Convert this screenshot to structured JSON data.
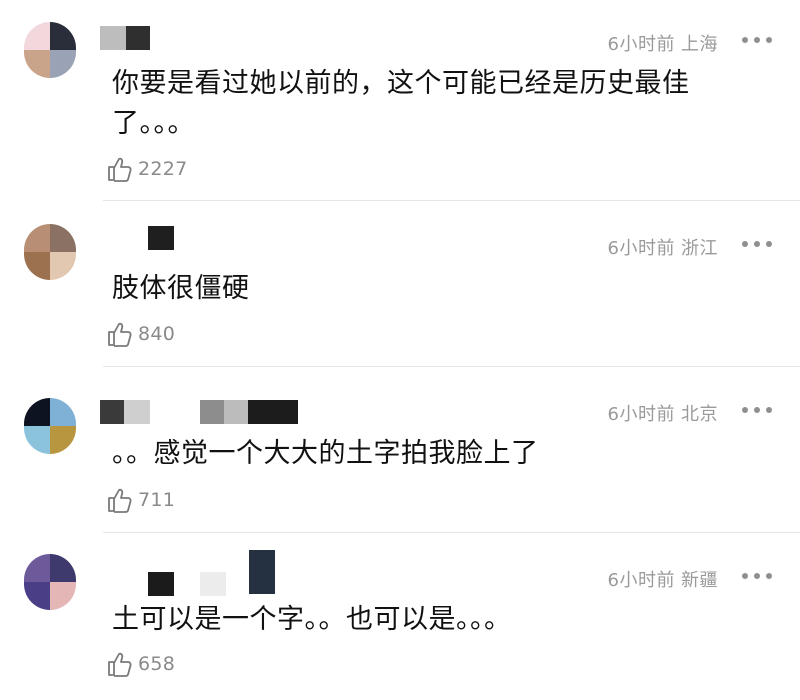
{
  "comments": [
    {
      "time": "6小时前",
      "location": "上海",
      "text": "你要是看过她以前的，这个可能已经是历史最佳了。。。",
      "likes": "2227"
    },
    {
      "time": "6小时前",
      "location": "浙江",
      "text": "肢体很僵硬",
      "likes": "840"
    },
    {
      "time": "6小时前",
      "location": "北京",
      "text": "。。感觉一个大大的土字拍我脸上了",
      "likes": "711"
    },
    {
      "time": "6小时前",
      "location": "新疆",
      "text": "土可以是一个字。。也可以是。。。",
      "likes": "658"
    }
  ],
  "icons": {
    "like": "thumbs-up-icon",
    "more": "more-dots-icon"
  },
  "colors": {
    "meta": "#9a9a9a",
    "text": "#111111",
    "divider": "#e6e6e6"
  }
}
